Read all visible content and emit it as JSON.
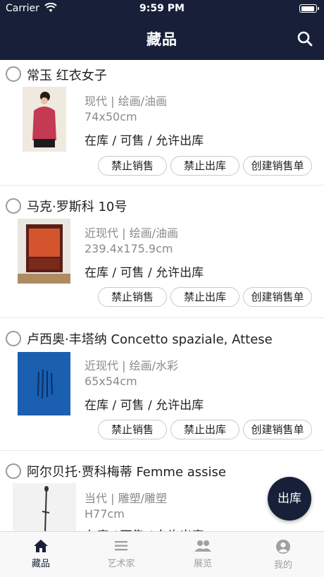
{
  "status_bar": {
    "carrier": "Carrier",
    "time": "9:59 PM"
  },
  "nav": {
    "title": "藏品",
    "search_icon": "search-icon"
  },
  "items": [
    {
      "title": "常玉 红衣女子",
      "category": "现代 | 绘画/油画",
      "size": "74x50cm",
      "status": "在库 / 可售 / 允许出库",
      "buttons": [
        "禁止销售",
        "禁止出库",
        "创建销售单"
      ]
    },
    {
      "title": "马克·罗斯科 10号",
      "category": "近现代 | 绘画/油画",
      "size": "239.4x175.9cm",
      "status": "在库 / 可售 / 允许出库",
      "buttons": [
        "禁止销售",
        "禁止出库",
        "创建销售单"
      ]
    },
    {
      "title": "卢西奥·丰塔纳 Concetto spaziale, Attese",
      "category": "近现代 | 绘画/水彩",
      "size": "65x54cm",
      "status": "在库 / 可售 / 允许出库",
      "buttons": [
        "禁止销售",
        "禁止出库",
        "创建销售单"
      ]
    },
    {
      "title": "阿尔贝托·贾科梅蒂 Femme assise",
      "category": "当代 | 雕塑/雕塑",
      "size": "H77cm",
      "status": "在库 / 可售 / 允许出库",
      "buttons": []
    }
  ],
  "fab": {
    "label": "出库"
  },
  "tabs": [
    {
      "label": "藏品",
      "icon": "home-icon",
      "active": true
    },
    {
      "label": "艺术家",
      "icon": "list-icon",
      "active": false
    },
    {
      "label": "展览",
      "icon": "people-icon",
      "active": false
    },
    {
      "label": "我的",
      "icon": "user-icon",
      "active": false
    }
  ],
  "colors": {
    "primary": "#172038",
    "muted": "#8a8a8a",
    "inactive_tab": "#a0a0a0"
  }
}
